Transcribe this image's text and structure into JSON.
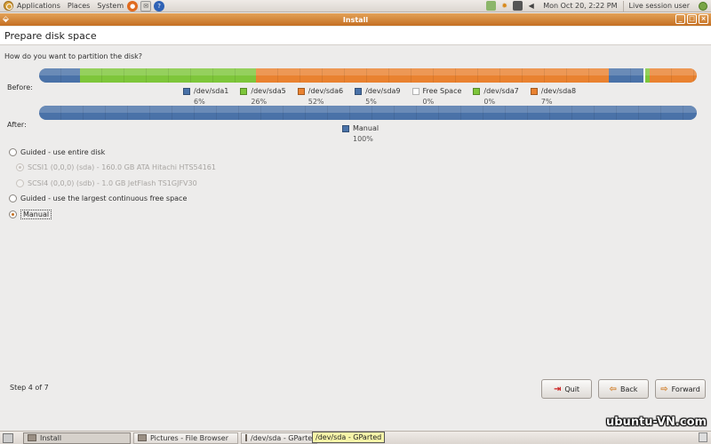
{
  "top_panel": {
    "menus": [
      "Applications",
      "Places",
      "System"
    ],
    "clock": "Mon Oct 20,  2:22 PM",
    "user": "Live session user"
  },
  "window": {
    "title": "Install"
  },
  "page": {
    "title": "Prepare disk space",
    "question": "How do you want to partition the disk?"
  },
  "partition_bars": {
    "before_label": "Before:",
    "after_label": "After:",
    "before_segments": [
      {
        "name": "/dev/sda1",
        "percent": 6,
        "color": "#4a72a8"
      },
      {
        "name": "/dev/sda5",
        "percent": 26,
        "color": "#7ec63a"
      },
      {
        "name": "/dev/sda6",
        "percent": 52,
        "color": "#e98230"
      },
      {
        "name": "/dev/sda9",
        "percent": 5,
        "color": "#4a72a8"
      },
      {
        "name": "Free Space",
        "percent": 0.3,
        "color": "#ffffff"
      },
      {
        "name": "/dev/sda7",
        "percent": 0.6,
        "color": "#7ec63a"
      },
      {
        "name": "/dev/sda8",
        "percent": 7,
        "color": "#e98230"
      }
    ],
    "before_legend": [
      {
        "label": "/dev/sda1",
        "pct": "6%",
        "color": "#4a72a8"
      },
      {
        "label": "/dev/sda5",
        "pct": "26%",
        "color": "#7ec63a"
      },
      {
        "label": "/dev/sda6",
        "pct": "52%",
        "color": "#e98230"
      },
      {
        "label": "/dev/sda9",
        "pct": "5%",
        "color": "#4a72a8"
      },
      {
        "label": "Free Space",
        "pct": "0%",
        "color": "#ffffff"
      },
      {
        "label": "/dev/sda7",
        "pct": "0%",
        "color": "#7ec63a"
      },
      {
        "label": "/dev/sda8",
        "pct": "7%",
        "color": "#e98230"
      }
    ],
    "after_legend": {
      "label": "Manual",
      "pct": "100%",
      "color": "#4a72a8"
    }
  },
  "options": {
    "guided_entire": "Guided - use entire disk",
    "disk1": "SCSI1 (0,0,0) (sda) - 160.0 GB ATA Hitachi HTS54161",
    "disk2": "SCSI4 (0,0,0) (sdb) - 1.0 GB JetFlash TS1GJFV30",
    "guided_largest": "Guided - use the largest continuous free space",
    "manual": "Manual"
  },
  "footer": {
    "step": "Step 4 of 7",
    "quit": "Quit",
    "back": "Back",
    "forward": "Forward"
  },
  "watermark": "ubuntu-VN.com",
  "taskbar": {
    "tasks": [
      "Install",
      "Pictures - File Browser",
      "/dev/sda - GParted"
    ],
    "tooltip": "/dev/sda - GParted"
  }
}
